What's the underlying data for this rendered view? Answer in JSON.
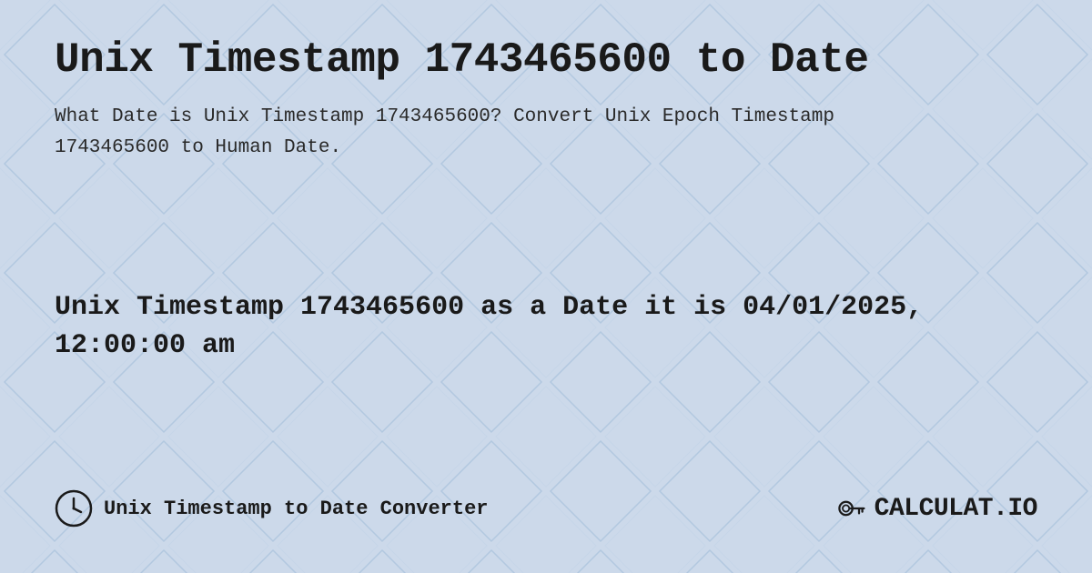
{
  "page": {
    "title": "Unix Timestamp 1743465600 to Date",
    "description": "What Date is Unix Timestamp 1743465600? Convert Unix Epoch Timestamp 1743465600 to Human Date.",
    "result": "Unix Timestamp 1743465600 as a Date it is 04/01/2025, 12:00:00 am",
    "background_color": "#c8daf0"
  },
  "footer": {
    "label": "Unix Timestamp to Date Converter",
    "logo_text": "CALCULAT.IO"
  }
}
